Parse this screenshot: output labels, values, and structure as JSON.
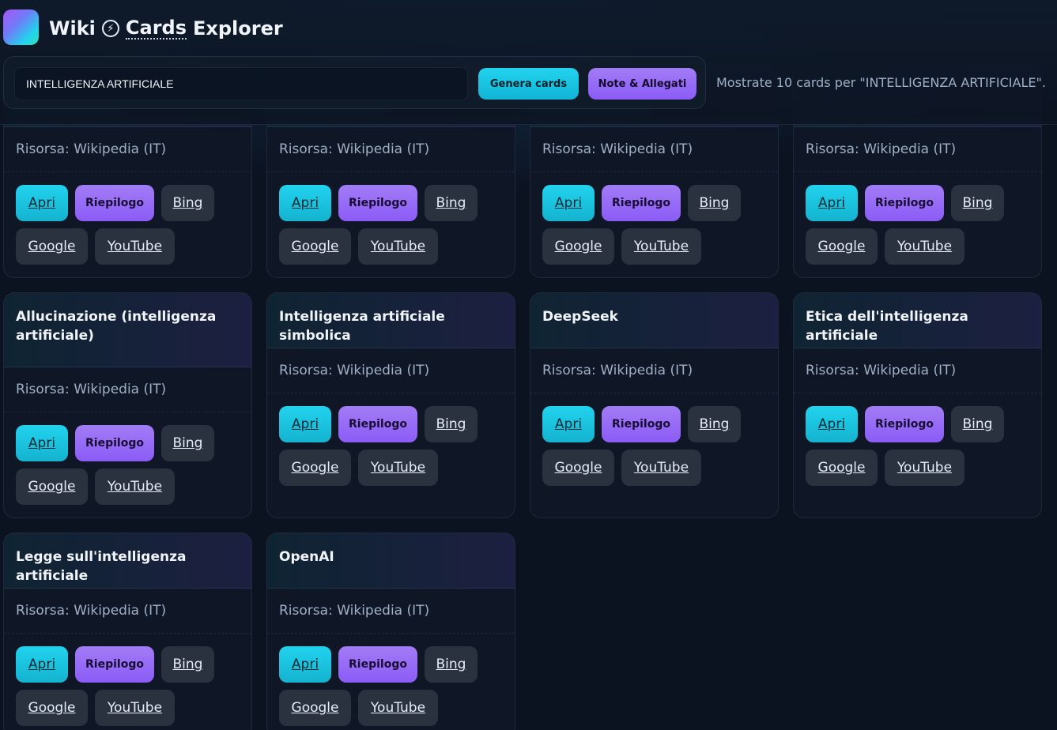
{
  "header": {
    "title_pre": "Wiki",
    "title_icon": "bolt-icon",
    "title_cards": "Cards",
    "title_post": "Explorer"
  },
  "search": {
    "value": "INTELLIGENZA ARTIFICIALE",
    "generate_label": "Genera cards",
    "notes_label": "Note & Allegati"
  },
  "status_text": "Mostrate 10 cards per \"INTELLIGENZA ARTIFICIALE\".",
  "card_actions": {
    "open": "Apri",
    "summary": "Riepilogo",
    "bing": "Bing",
    "google": "Google",
    "youtube": "YouTube"
  },
  "cards": [
    {
      "title": "",
      "source": "Risorsa: Wikipedia (IT)"
    },
    {
      "title": "",
      "source": "Risorsa: Wikipedia (IT)"
    },
    {
      "title": "",
      "source": "Risorsa: Wikipedia (IT)"
    },
    {
      "title": "",
      "source": "Risorsa: Wikipedia (IT)"
    },
    {
      "title": "Allucinazione (intelligenza artificiale)",
      "source": "Risorsa: Wikipedia (IT)"
    },
    {
      "title": "Intelligenza artificiale simbolica",
      "source": "Risorsa: Wikipedia (IT)"
    },
    {
      "title": "DeepSeek",
      "source": "Risorsa: Wikipedia (IT)"
    },
    {
      "title": "Etica dell'intelligenza artificiale",
      "source": "Risorsa: Wikipedia (IT)"
    },
    {
      "title": "Legge sull'intelligenza artificiale",
      "source": "Risorsa: Wikipedia (IT)"
    },
    {
      "title": "OpenAI",
      "source": "Risorsa: Wikipedia (IT)"
    }
  ]
}
